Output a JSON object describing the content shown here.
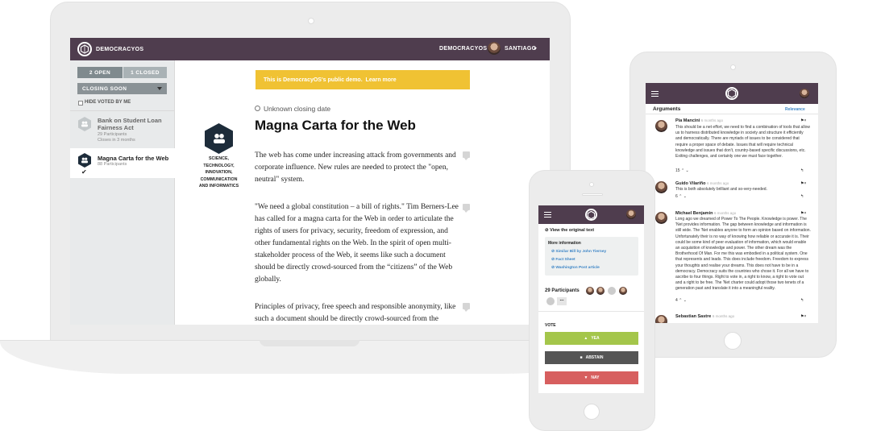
{
  "colors": {
    "header": "#4f3d4e",
    "banner": "#f0c233",
    "yea": "#a4c64b",
    "abstain": "#555555",
    "nay": "#d75f5f",
    "link": "#3d85c6"
  },
  "laptop": {
    "brand": "DEMOCRACYOS",
    "nav_right": "DEMOCRACYOS",
    "user": "SANTIAGO",
    "tabs": {
      "open": "2 OPEN",
      "closed": "1 CLOSED"
    },
    "sort_select": "CLOSING SOON",
    "hide_voted": "HIDE VOTED BY ME",
    "sidebar_items": [
      {
        "title": "Bank on Student Loan Fairness Act",
        "participants": "29 Participants",
        "closes": "Closes in 3 months"
      },
      {
        "title": "Magna Carta for the Web",
        "participants": "88 Participants"
      }
    ],
    "banner_text": "This is DemocracyOS's public demo.",
    "banner_link": "Learn more",
    "closing_date": "Unknown closing date",
    "title": "Magna Carta for the Web",
    "category_label": "SCIENCE, TECHNOLOGY, INNOVATION, COMMUNICATION AND INFORMATICS",
    "paragraphs": [
      "The web has come under increasing attack from governments and corporate influence. New rules are needed to protect the \"open, neutral\" system.",
      "\"We need a global constitution – a bill of rights.\" Tim Berners-Lee has called for a magna carta for the Web in order to articulate the rights of users for privacy, security, freedom of expression, and other fundamental rights on the Web. In the spirit of open multi-stakeholder process of the Web, it seems like such a document should be directly crowd-sourced from the “citizens” of the Web globally.",
      "Principles of privacy, free speech and responsible anonymity, like such a document should be directly crowd-sourced from the"
    ]
  },
  "tablet": {
    "section_title": "Arguments",
    "sort_label": "Relevance",
    "comments": [
      {
        "name": "Pia Mancini",
        "time": "6 months ago",
        "text": "This should be a net effort, we need to find a combination of tools that allow us to harness distributed knowledge in society and structure it efficiently and democratically. There are myriads of issues to be considered that require a proper space of debate. Issues that will require technical knowledge and issues that don't, country-based specific discussions, etc. Exiting challenges, and certainly one we must face together.",
        "score": "15"
      },
      {
        "name": "Guido Vilariño",
        "time": "6 months ago",
        "text": "This is both absolutely brilliant and so-very-needed.",
        "score": "6"
      },
      {
        "name": "Michael Benjamin",
        "time": "6 months ago",
        "text": "Long ago we dreamed of Power To The People. Knowledge is power. The 'Net provides information. The gap between knowledge and information is still wide. The 'Net enables anyone to form an opinion based on information. Unfortunately their is no way of knowing how reliable or accurate it is. Their could be some kind of peer evaluation of information, which would enable an acquisition of knowledge and power. The other dream was the Brotherhood Of Man. For me this was embodied in a political system. One that represents and leads. This does include freedom. Freedom to express your thoughts and realise your dreams. This does not have to be in a democracy. Democracy suits the countries who chose it. For all we have to ascribe to four things. Right to vote in, a right to know, a right to vote out and a right to be free. The 'Net charter could adopt those two tenets of a generation past and translate it into a meaningful reality.",
        "score": "4"
      },
      {
        "name": "Sebastian Sastre",
        "time": "6 months ago"
      }
    ]
  },
  "phone": {
    "view_original": "View the original text",
    "more_info_title": "More information",
    "links": [
      "Similar Bill by John Tierney",
      "Fact Sheet",
      "Washington Post article"
    ],
    "participants": "29 Participants",
    "more": "...",
    "vote_label": "VOTE",
    "buttons": {
      "yea": "YEA",
      "abstain": "ABSTAIN",
      "nay": "NAY"
    }
  }
}
